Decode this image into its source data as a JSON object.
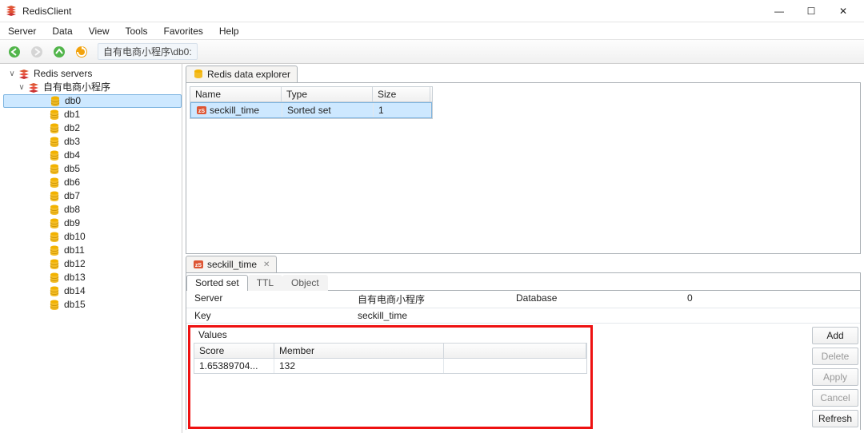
{
  "window": {
    "title": "RedisClient"
  },
  "menu": [
    "Server",
    "Data",
    "View",
    "Tools",
    "Favorites",
    "Help"
  ],
  "addressbar": "自有电商小程序\\db0:",
  "tree": {
    "root": "Redis servers",
    "server": "自有电商小程序",
    "selected_db": "db0",
    "dbs": [
      "db0",
      "db1",
      "db2",
      "db3",
      "db4",
      "db5",
      "db6",
      "db7",
      "db8",
      "db9",
      "db10",
      "db11",
      "db12",
      "db13",
      "db14",
      "db15"
    ]
  },
  "explorer": {
    "tab_label": "Redis data explorer",
    "columns": {
      "name": "Name",
      "type": "Type",
      "size": "Size"
    },
    "row": {
      "name": "seckill_time",
      "type": "Sorted set",
      "size": "1"
    }
  },
  "detail": {
    "tab_label": "seckill_time",
    "subtabs": {
      "sortedset": "Sorted set",
      "ttl": "TTL",
      "object": "Object"
    },
    "server_label": "Server",
    "server_value": "自有电商小程序",
    "database_label": "Database",
    "database_value": "0",
    "key_label": "Key",
    "key_value": "seckill_time",
    "values_label": "Values",
    "value_headers": {
      "score": "Score",
      "member": "Member"
    },
    "value_row": {
      "score": "1.65389704...",
      "member": "132"
    }
  },
  "buttons": {
    "add": "Add",
    "delete": "Delete",
    "apply": "Apply",
    "cancel": "Cancel",
    "refresh": "Refresh"
  }
}
